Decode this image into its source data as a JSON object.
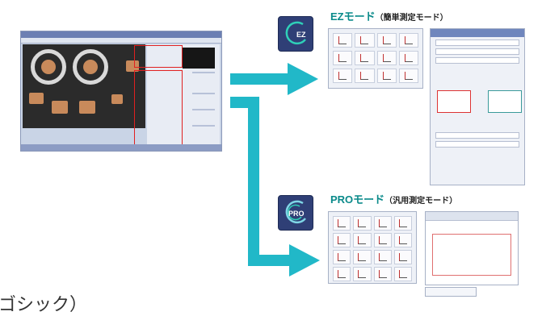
{
  "ez_mode": {
    "icon_text": "EZ",
    "title": "EZモード",
    "subtitle": "（簡単測定モード）"
  },
  "pro_mode": {
    "icon_text": "PRO",
    "title": "PROモード",
    "subtitle": "（汎用測定モード）"
  },
  "bottom_fragment": "ゴシック）",
  "colors": {
    "arrow": "#21b8c8",
    "title": "#0a8a8a",
    "icon_bg": "#2f3f76",
    "highlight": "#e02020"
  },
  "icons": {
    "ez": "ez-mode-icon",
    "pro": "pro-mode-icon"
  }
}
